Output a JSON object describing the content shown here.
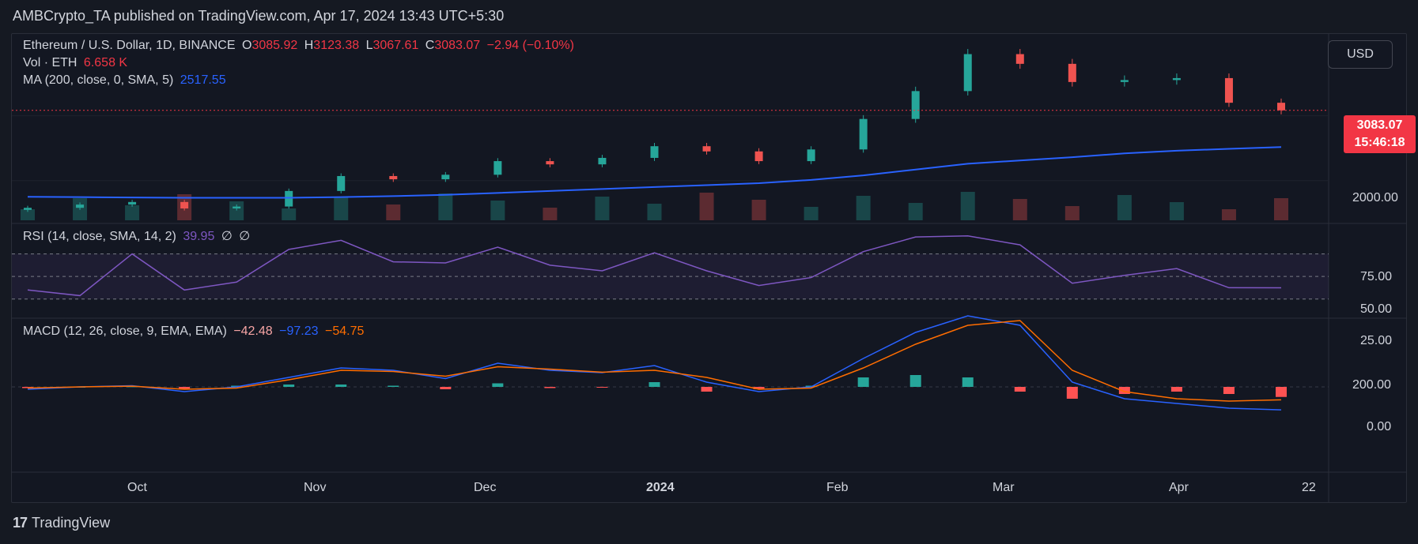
{
  "header": {
    "publisher": "AMBCrypto_TA published on TradingView.com, Apr 17, 2024 13:43 UTC+5:30"
  },
  "currency_button": "USD",
  "symbol_legend": {
    "title": "Ethereum / U.S. Dollar, 1D, BINANCE",
    "o_label": "O",
    "o_value": "3085.92",
    "h_label": "H",
    "h_value": "3123.38",
    "l_label": "L",
    "l_value": "3067.61",
    "c_label": "C",
    "c_value": "3083.07",
    "change": "−2.94 (−0.10%)"
  },
  "volume_legend": {
    "label": "Vol · ETH",
    "value": "6.658 K"
  },
  "ma_legend": {
    "label": "MA (200, close, 0, SMA, 5)",
    "value": "2517.55"
  },
  "rsi_legend": {
    "label": "RSI (14, close, SMA, 14, 2)",
    "value": "39.95",
    "na1": "∅",
    "na2": "∅"
  },
  "macd_legend": {
    "label": "MACD (12, 26, close, 9, EMA, EMA)",
    "hist": "−42.48",
    "macd": "−97.23",
    "signal": "−54.75"
  },
  "price_tag": {
    "price": "3083.07",
    "countdown": "15:46:18"
  },
  "price_axis": {
    "tick": "2000.00"
  },
  "rsi_axis": [
    "75.00",
    "50.00",
    "25.00"
  ],
  "macd_axis": [
    "200.00",
    "0.00"
  ],
  "time_axis": [
    "Oct",
    "Nov",
    "Dec",
    "2024",
    "Feb",
    "Mar",
    "Apr",
    "22"
  ],
  "footer": {
    "brand": "TradingView"
  },
  "colors": {
    "up": "#26a69a",
    "down": "#ef5350",
    "ma": "#2962ff",
    "rsi": "#7e57c2",
    "macd": "#2962ff",
    "signal": "#ff6d00"
  },
  "chart_data": {
    "type": "line",
    "title": "Ethereum / U.S. Dollar, 1D, BINANCE",
    "x_ticks": [
      "Oct",
      "Nov",
      "Dec",
      "2024",
      "Feb",
      "Mar",
      "Apr",
      "22"
    ],
    "price": {
      "dates": [
        "Sep 12",
        "Sep 20",
        "Oct 1",
        "Oct 10",
        "Oct 20",
        "Nov 1",
        "Nov 10",
        "Nov 20",
        "Dec 1",
        "Dec 10",
        "Dec 20",
        "Jan 1",
        "Jan 10",
        "Jan 20",
        "Feb 1",
        "Feb 10",
        "Feb 20",
        "Mar 1",
        "Mar 10",
        "Mar 15",
        "Mar 20",
        "Apr 1",
        "Apr 8",
        "Apr 12",
        "Apr 17"
      ],
      "close": [
        1580,
        1630,
        1670,
        1570,
        1600,
        1840,
        2070,
        2020,
        2090,
        2300,
        2250,
        2350,
        2530,
        2450,
        2300,
        2480,
        2950,
        3380,
        3950,
        3800,
        3520,
        3550,
        3580,
        3200,
        3083
      ],
      "ma200": [
        1750,
        1745,
        1740,
        1735,
        1735,
        1735,
        1745,
        1760,
        1780,
        1810,
        1840,
        1870,
        1900,
        1930,
        1960,
        2010,
        2080,
        2170,
        2260,
        2310,
        2360,
        2420,
        2460,
        2490,
        2517.55
      ],
      "y_tick": 2000
    },
    "rsi": {
      "values": [
        38,
        33,
        70,
        38,
        45,
        74,
        82,
        63,
        62,
        76,
        60,
        55,
        71,
        55,
        42,
        49,
        72,
        85,
        86,
        78,
        44,
        51,
        57,
        40,
        39.95
      ],
      "levels": [
        70,
        50,
        30
      ],
      "y_ticks": [
        75,
        50,
        25
      ]
    },
    "macd": {
      "macd": [
        -10,
        0,
        5,
        -20,
        0,
        40,
        80,
        70,
        35,
        100,
        70,
        60,
        90,
        20,
        -20,
        0,
        120,
        230,
        300,
        260,
        20,
        -50,
        -70,
        -90,
        -97.23
      ],
      "signal": [
        -5,
        0,
        3,
        -10,
        -5,
        30,
        70,
        65,
        45,
        85,
        75,
        62,
        70,
        40,
        -10,
        -5,
        80,
        180,
        260,
        280,
        70,
        -20,
        -50,
        -60,
        -54.75
      ],
      "y_ticks": [
        200,
        0
      ]
    }
  }
}
